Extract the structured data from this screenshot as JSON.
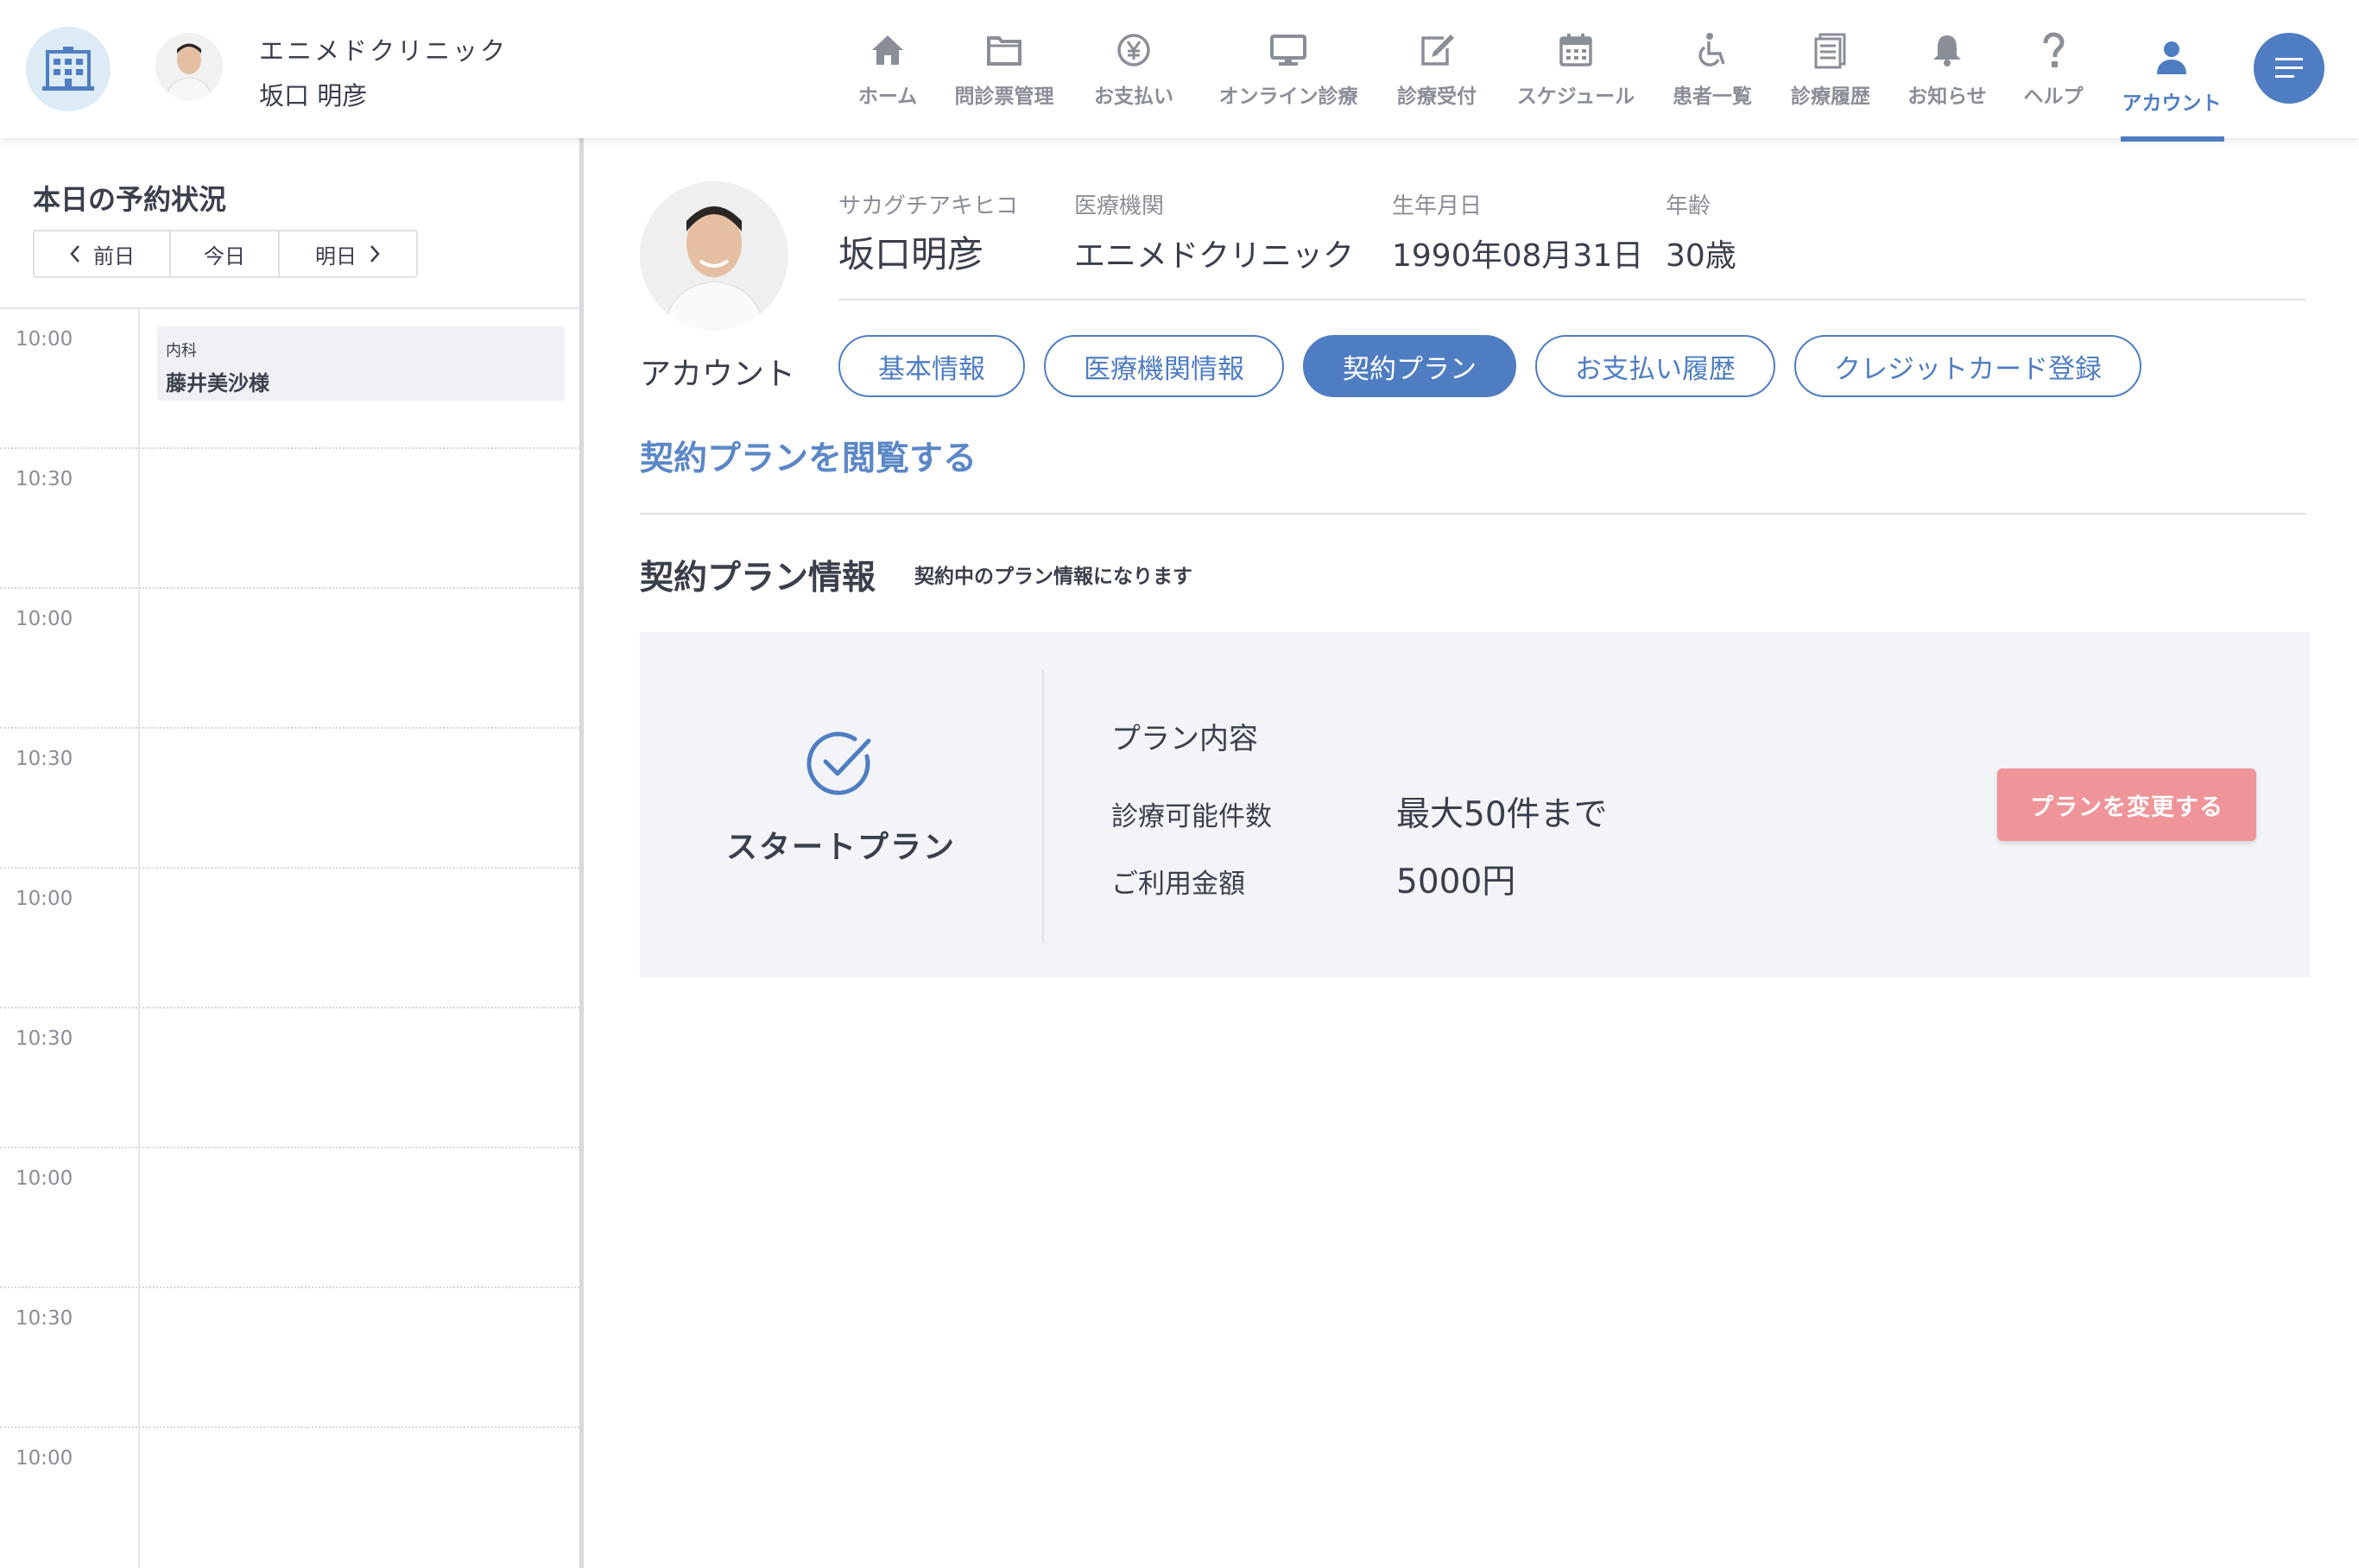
{
  "header": {
    "clinic_name": "エニメドクリニック",
    "user_name": "坂口 明彦",
    "nav": [
      {
        "label": "ホーム",
        "icon": "home-icon"
      },
      {
        "label": "問診票管理",
        "icon": "folder-icon"
      },
      {
        "label": "お支払い",
        "icon": "yen-icon"
      },
      {
        "label": "オンライン診療",
        "icon": "monitor-icon"
      },
      {
        "label": "診療受付",
        "icon": "edit-icon"
      },
      {
        "label": "スケジュール",
        "icon": "calendar-icon"
      },
      {
        "label": "患者一覧",
        "icon": "wheelchair-icon"
      },
      {
        "label": "診療履歴",
        "icon": "document-icon"
      },
      {
        "label": "お知らせ",
        "icon": "bell-icon"
      },
      {
        "label": "ヘルプ",
        "icon": "question-icon"
      },
      {
        "label": "アカウント",
        "icon": "user-icon",
        "active": true
      }
    ],
    "accent_color": "#4f7dc2"
  },
  "sidebar": {
    "title": "本日の予約状況",
    "prev_label": "前日",
    "today_label": "今日",
    "next_label": "明日",
    "slots": [
      {
        "time": "10:00",
        "appointment": {
          "department": "内科",
          "patient": "藤井美沙様"
        }
      },
      {
        "time": "10:30"
      },
      {
        "time": "10:00"
      },
      {
        "time": "10:30"
      },
      {
        "time": "10:00"
      },
      {
        "time": "10:30"
      },
      {
        "time": "10:00"
      },
      {
        "time": "10:30"
      },
      {
        "time": "10:00"
      }
    ]
  },
  "profile": {
    "account_label": "アカウント",
    "kana": "サカグチアキヒコ",
    "name": "坂口明彦",
    "institution_label": "医療機関",
    "institution": "エニメドクリニック",
    "birthday_label": "生年月日",
    "birthday": "1990年08月31日",
    "age_label": "年齢",
    "age": "30歳"
  },
  "tabs": [
    {
      "label": "基本情報"
    },
    {
      "label": "医療機関情報"
    },
    {
      "label": "契約プラン",
      "active": true
    },
    {
      "label": "お支払い履歴"
    },
    {
      "label": "クレジットカード登録"
    }
  ],
  "plan": {
    "section_link": "契約プランを閲覧する",
    "heading": "契約プラン情報",
    "subheading": "契約中のプラン情報になります",
    "name": "スタートプラン",
    "content_title": "プラン内容",
    "rows": [
      {
        "label": "診療可能件数",
        "value": "最大50件まで"
      },
      {
        "label": "ご利用金額",
        "value": "5000円"
      }
    ],
    "change_button": "プランを変更する",
    "button_color": "#ef959a"
  }
}
